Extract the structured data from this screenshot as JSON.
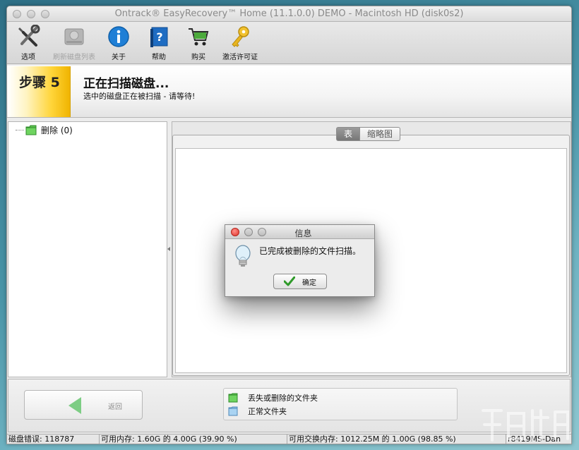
{
  "window": {
    "title": "Ontrack® EasyRecovery™ Home (11.1.0.0) DEMO - Macintosh HD (disk0s2)"
  },
  "toolbar": {
    "items": [
      {
        "label": "选项",
        "icon": "tools-icon",
        "enabled": true
      },
      {
        "label": "刷新磁盘列表",
        "icon": "hard-drive-icon",
        "enabled": false
      },
      {
        "label": "关于",
        "icon": "info-icon",
        "enabled": true
      },
      {
        "label": "帮助",
        "icon": "help-book-icon",
        "enabled": true
      },
      {
        "label": "购买",
        "icon": "shopping-cart-icon",
        "enabled": true
      },
      {
        "label": "激活许可证",
        "icon": "key-icon",
        "enabled": true
      }
    ]
  },
  "step": {
    "label": "步骤 5",
    "heading": "正在扫描磁盘...",
    "subheading": "选中的磁盘正在被扫描 - 请等待!"
  },
  "tree": {
    "items": [
      {
        "label": "删除 (0)",
        "icon": "green-folder-icon"
      }
    ]
  },
  "tabs": [
    {
      "label": "表",
      "active": true
    },
    {
      "label": "缩略图",
      "active": false
    }
  ],
  "back_button": {
    "label": "返回",
    "enabled": false
  },
  "legend": {
    "items": [
      {
        "label": "丢失或删除的文件夹",
        "color": "#5cc24f"
      },
      {
        "label": "正常文件夹",
        "color": "#8fc3ea"
      }
    ]
  },
  "statusbar": {
    "disk_errors": "磁盘错误: 118787",
    "memory": "可用内存: 1.60G 的 4.00G (39.90 %)",
    "swap": "可用交换内存: 1012.25M 的 1.00G (98.85 %)",
    "user": "r8419MS-Dan"
  },
  "dialog": {
    "title": "信息",
    "message": "已完成被删除的文件扫描。",
    "ok_label": "确定"
  },
  "colors": {
    "step_yellow": "#ffd53a",
    "green_folder": "#5cc24f",
    "blue_folder": "#8fc3ea",
    "close_red": "#ee4a43"
  }
}
